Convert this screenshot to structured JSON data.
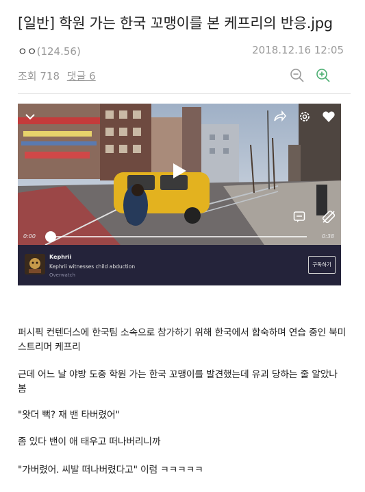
{
  "post": {
    "title": "[일반] 학원 가는 한국 꼬맹이를 본 케프리의 반응.jpg",
    "author_name": "ㅇㅇ",
    "author_ip": "(124.56)",
    "datetime": "2018.12.16 12:05",
    "views_label": "조회 718",
    "comments_label": "댓글 6"
  },
  "video": {
    "time_current": "0:00",
    "time_total": "0:38",
    "progress": 0,
    "channel_name": "Kephrii",
    "title": "Kephrii witnesses child abduction",
    "game": "Overwatch",
    "subscribe_label": "구독하기"
  },
  "body": {
    "p1": "퍼시픽 컨텐더스에 한국팀 소속으로 참가하기 위해 한국에서 합숙하며 연습 중인 북미 스트리머 케프리",
    "p2": "근데 어느 날 야방 도중 학원 가는 한국 꼬맹이를 발견했는데 유괴 당하는 줄 알았나 봄",
    "p3": "\"왓더 뻑? 재 밴 타버렸어\"",
    "p4": "좀 있다 밴이 애 태우고 떠나버리니까",
    "p5": "\"가버렸어. 씨발 떠나버렸다고\" 이럼 ㅋㅋㅋㅋㅋ"
  },
  "colors": {
    "accent_green": "#4caf72",
    "meta_gray": "#9a9a9a",
    "video_bar": "#24233a"
  },
  "icons": {
    "zoom_out": "zoom-out-icon",
    "zoom_in": "zoom-in-icon",
    "share": "share-icon",
    "settings": "gear-icon",
    "like": "heart-icon",
    "captions": "captions-icon",
    "rotate": "rotate-icon",
    "play": "play-icon"
  }
}
